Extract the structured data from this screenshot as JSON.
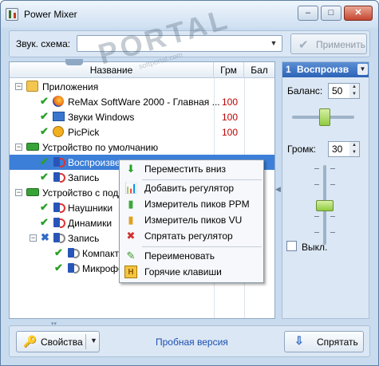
{
  "window": {
    "title": "Power Mixer",
    "buttons": {
      "minimize": "–",
      "maximize": "□",
      "close": "✕"
    },
    "watermark": "PORTAL",
    "watermark_small": "softportal.com",
    "watermark_tm": "TM"
  },
  "scheme": {
    "label": "Звук. схема:",
    "value": "",
    "apply_label": "Применить"
  },
  "tree": {
    "columns": {
      "name": "Название",
      "grm": "Грм",
      "bal": "Бал"
    },
    "rows": [
      {
        "name": "Приложения",
        "grm": ""
      },
      {
        "name": "ReMax SoftWare 2000 - Главная ...",
        "grm": "100"
      },
      {
        "name": "Звуки Windows",
        "grm": "100"
      },
      {
        "name": "PicPick",
        "grm": "100"
      },
      {
        "name": "Устройство по умолчанию",
        "grm": ""
      },
      {
        "name": "Воспроизве",
        "grm": ""
      },
      {
        "name": "Запись",
        "grm": ""
      },
      {
        "name": "Устройство с подд",
        "grm": ""
      },
      {
        "name": "Наушники",
        "grm": ""
      },
      {
        "name": "Динамики",
        "grm": ""
      },
      {
        "name": "Запись",
        "grm": ""
      },
      {
        "name": "Компакт-",
        "grm": ""
      },
      {
        "name": "Микрофо",
        "grm": ""
      }
    ]
  },
  "context_menu": {
    "items": [
      "Переместить вниз",
      "Добавить регулятор",
      "Измеритель пиков PPM",
      "Измеритель пиков VU",
      "Спрятать регулятор",
      "Переименовать",
      "Горячие клавиши"
    ]
  },
  "control": {
    "index": "1",
    "name": "Воспроизв",
    "balance_label": "Баланс:",
    "balance_value": "50",
    "volume_label": "Громк:",
    "volume_value": "30",
    "mute_label": "Выкл."
  },
  "bottom": {
    "properties_label": "Свойства",
    "trial_text": "Пробная версия",
    "hide_label": "Спрятать"
  },
  "colors": {
    "selection": "#3c7fd8",
    "value_red": "#c00000",
    "check_green": "#2aa02a",
    "slider_thumb": "#8fcb3f",
    "trial_blue": "#1d4fb0"
  },
  "icons": {
    "tick": "✔",
    "cross": "✖",
    "move_down": "⬇",
    "add": "📊",
    "ppm": "▮",
    "vu": "▮",
    "hide": "✖",
    "rename": "✎",
    "hotkeys": "H",
    "key": "🔑",
    "hide_arrow": "⇩",
    "dropdown": "▼",
    "spin_up": "▲",
    "spin_down": "▼",
    "grip": "▾▾"
  }
}
